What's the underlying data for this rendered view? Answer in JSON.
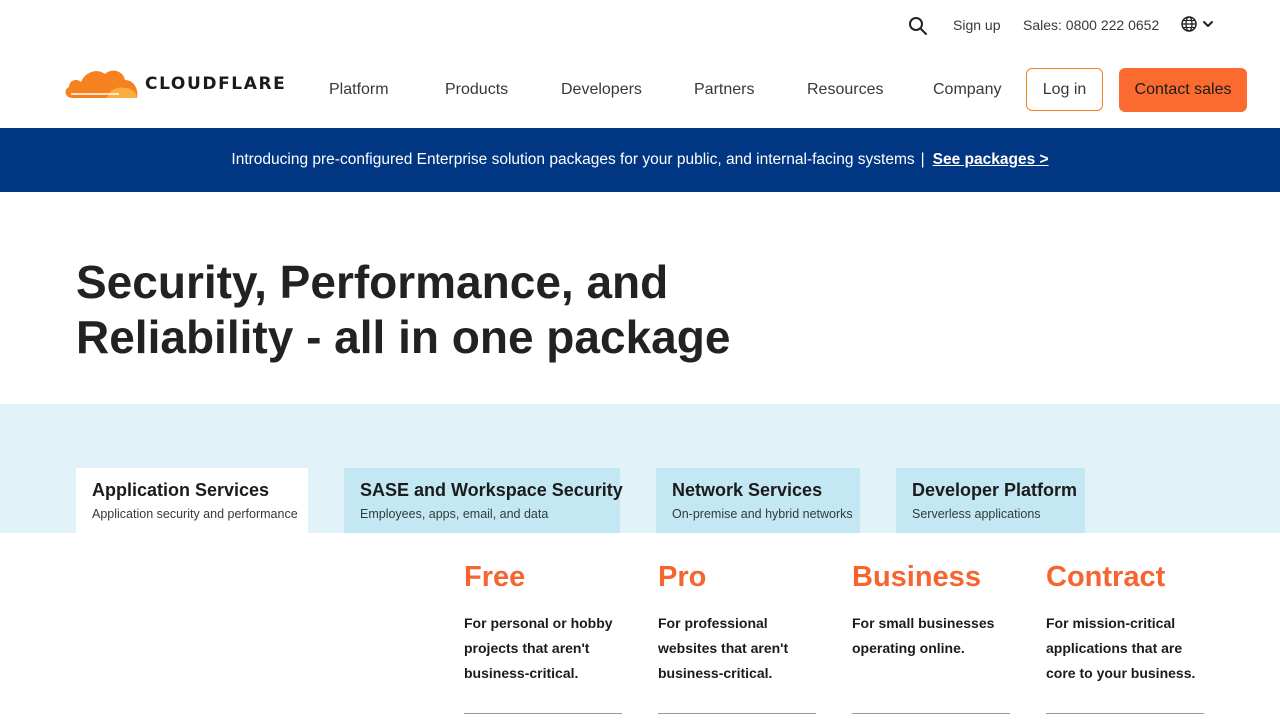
{
  "utility": {
    "search_icon": "search-icon",
    "signup": "Sign up",
    "sales": "Sales: 0800 222 0652",
    "language_icon": "globe-icon"
  },
  "brand": {
    "name": "CLOUDFLARE",
    "color": "#f6821f"
  },
  "nav": {
    "items": [
      "Platform",
      "Products",
      "Developers",
      "Partners",
      "Resources",
      "Company"
    ],
    "login": "Log in",
    "contact": "Contact sales"
  },
  "banner": {
    "text": "Introducing pre-configured Enterprise solution packages for your public, and internal-facing systems",
    "separator": "|",
    "link": "See packages >",
    "background": "#003682"
  },
  "hero": {
    "title_line1": "Security, Performance, and",
    "title_line2": "Reliability - all in one package"
  },
  "tabs": [
    {
      "title": "Application Services",
      "subtitle": "Application security and performance",
      "active": true
    },
    {
      "title": "SASE and Workspace Security",
      "subtitle": "Employees, apps, email, and data",
      "active": false
    },
    {
      "title": "Network Services",
      "subtitle": "On-premise and hybrid networks",
      "active": false
    },
    {
      "title": "Developer Platform",
      "subtitle": "Serverless applications",
      "active": false
    }
  ],
  "plans": [
    {
      "name": "Free",
      "desc_lines": [
        "For personal or hobby",
        "projects that aren't",
        "business-critical."
      ]
    },
    {
      "name": "Pro",
      "desc_lines": [
        "For professional",
        "websites that aren't",
        "business-critical."
      ]
    },
    {
      "name": "Business",
      "desc_lines": [
        "For small businesses",
        "operating online."
      ]
    },
    {
      "name": "Contract",
      "desc_lines": [
        "For mission-critical",
        "applications that are",
        "core to your business."
      ]
    }
  ],
  "colors": {
    "accent_orange": "#fb6b2f",
    "plan_orange": "#f6652f",
    "tab_band": "#e1f2f8",
    "tab_inactive": "#c3e8f4"
  }
}
